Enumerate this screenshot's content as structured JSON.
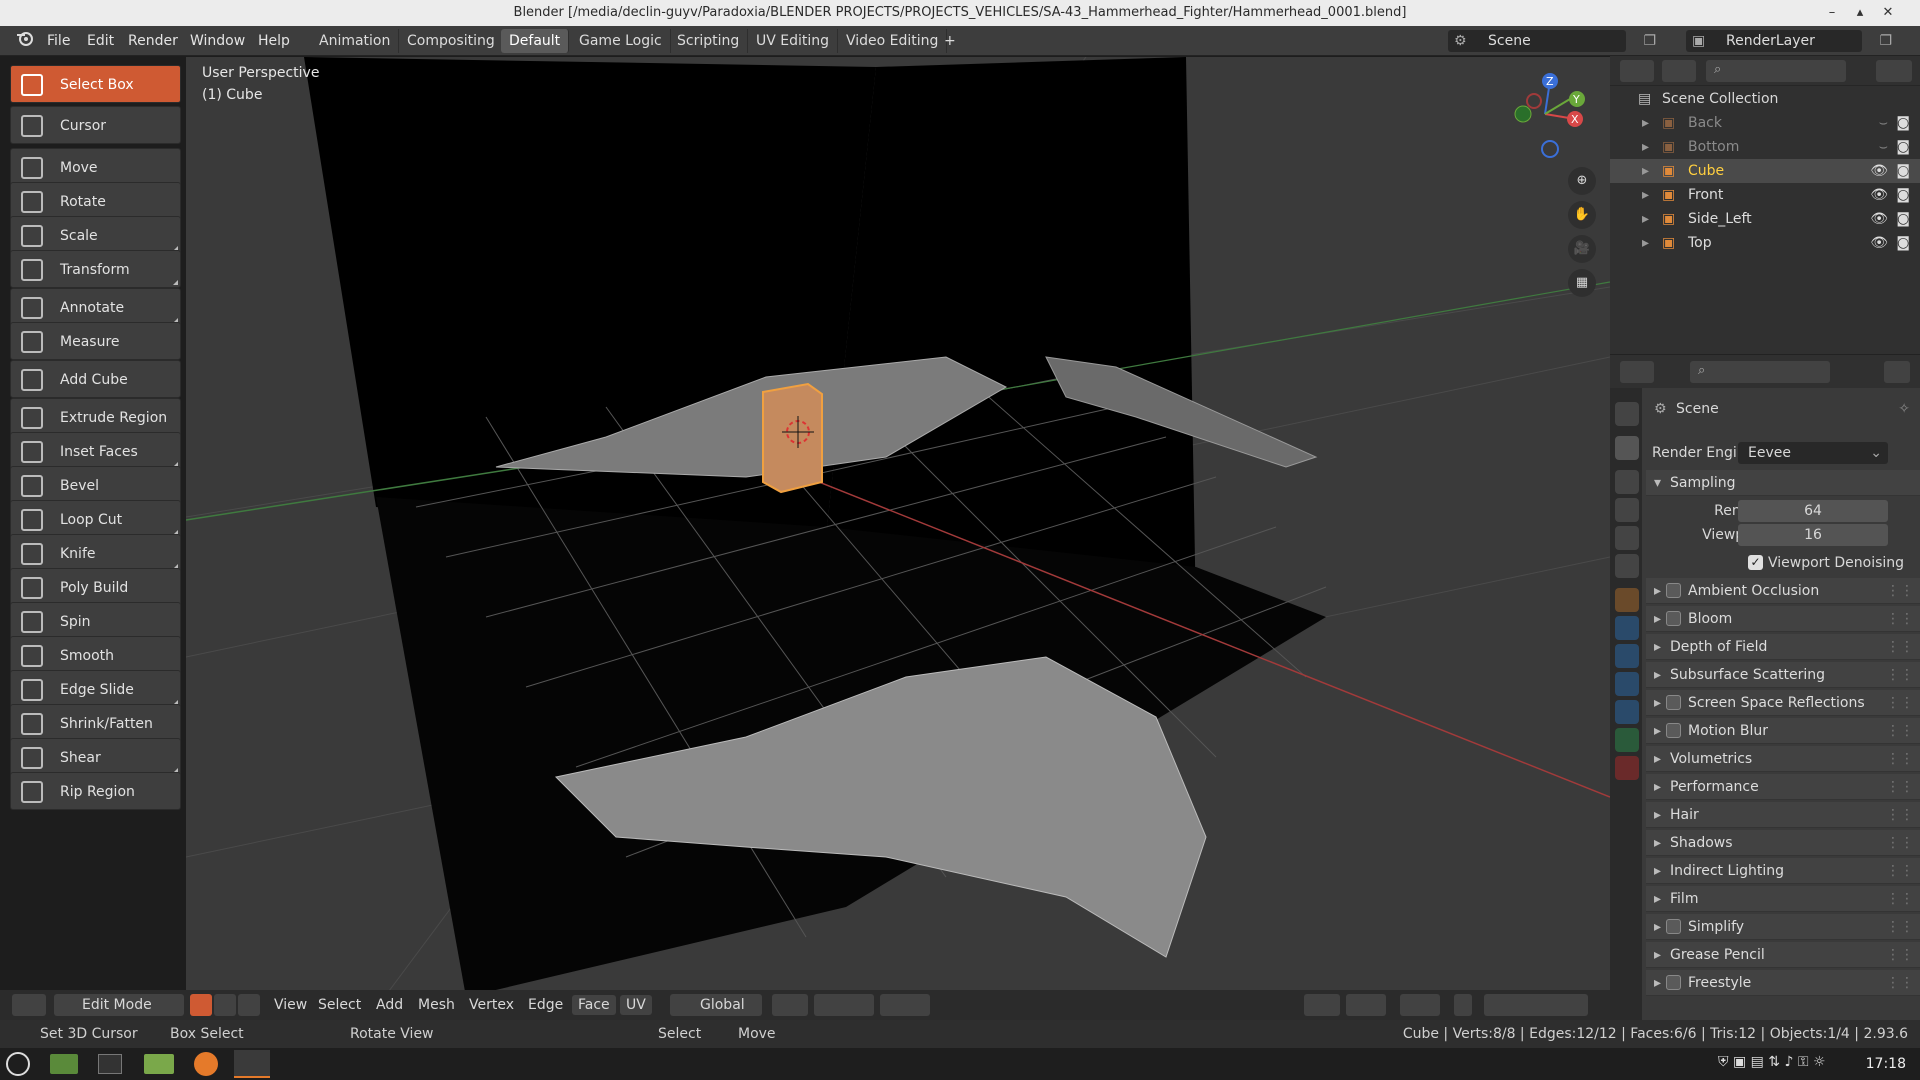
{
  "window": {
    "title": "Blender [/media/declin-guyv/Paradoxia/BLENDER PROJECTS/PROJECTS_VEHICLES/SA-43_Hammerhead_Fighter/Hammerhead_0001.blend]"
  },
  "menu": [
    "File",
    "Edit",
    "Render",
    "Window",
    "Help"
  ],
  "workspaces": [
    {
      "label": "Animation"
    },
    {
      "label": "Compositing"
    },
    {
      "label": "Default",
      "active": true
    },
    {
      "label": "Game Logic"
    },
    {
      "label": "Scripting"
    },
    {
      "label": "UV Editing"
    },
    {
      "label": "Video Editing"
    }
  ],
  "scene_field": "Scene",
  "renderlayer_field": "RenderLayer",
  "tools": [
    {
      "label": "Select Box",
      "active": true,
      "icon": "select-box-icon"
    },
    {
      "label": "Cursor",
      "icon": "cursor-icon"
    },
    {
      "label": "Move",
      "icon": "move-icon"
    },
    {
      "label": "Rotate",
      "icon": "rotate-icon"
    },
    {
      "label": "Scale",
      "icon": "scale-icon"
    },
    {
      "label": "Transform",
      "icon": "transform-icon"
    },
    {
      "label": "Annotate",
      "icon": "annotate-icon"
    },
    {
      "label": "Measure",
      "icon": "measure-icon"
    },
    {
      "label": "Add Cube",
      "icon": "add-cube-icon"
    },
    {
      "label": "Extrude Region",
      "icon": "extrude-icon"
    },
    {
      "label": "Inset Faces",
      "icon": "inset-icon"
    },
    {
      "label": "Bevel",
      "icon": "bevel-icon"
    },
    {
      "label": "Loop Cut",
      "icon": "loop-cut-icon"
    },
    {
      "label": "Knife",
      "icon": "knife-icon"
    },
    {
      "label": "Poly Build",
      "icon": "poly-build-icon"
    },
    {
      "label": "Spin",
      "icon": "spin-icon"
    },
    {
      "label": "Smooth",
      "icon": "smooth-icon"
    },
    {
      "label": "Edge Slide",
      "icon": "edge-slide-icon"
    },
    {
      "label": "Shrink/Fatten",
      "icon": "shrink-icon"
    },
    {
      "label": "Shear",
      "icon": "shear-icon"
    },
    {
      "label": "Rip Region",
      "icon": "rip-icon"
    }
  ],
  "viewport": {
    "perspective": "User Perspective",
    "object": "(1) Cube"
  },
  "vp_header": {
    "mode": "Edit Mode",
    "menus": [
      "View",
      "Select",
      "Add",
      "Mesh",
      "Vertex",
      "Edge",
      "Face",
      "UV"
    ],
    "orientation": "Global"
  },
  "statusbar": {
    "items": [
      "Set 3D Cursor",
      "Box Select",
      "Rotate View",
      "Select",
      "Move"
    ],
    "stats": "Cube | Verts:8/8 | Edges:12/12 | Faces:6/6 | Tris:12 | Objects:1/4 | 2.93.6"
  },
  "outliner": {
    "root": "Scene Collection",
    "items": [
      {
        "name": "Back",
        "dim": true
      },
      {
        "name": "Bottom",
        "dim": true
      },
      {
        "name": "Cube",
        "active": true
      },
      {
        "name": "Front"
      },
      {
        "name": "Side_Left"
      },
      {
        "name": "Top"
      }
    ]
  },
  "properties": {
    "context": "Scene",
    "render_engine_label": "Render Engine",
    "render_engine": "Eevee",
    "sampling": "Sampling",
    "render_label": "Render",
    "render_value": "64",
    "viewport_label": "Viewport",
    "viewport_value": "16",
    "denoise_label": "Viewport Denoising",
    "panels": [
      {
        "label": "Ambient Occlusion",
        "check": true
      },
      {
        "label": "Bloom",
        "check": true
      },
      {
        "label": "Depth of Field"
      },
      {
        "label": "Subsurface Scattering"
      },
      {
        "label": "Screen Space Reflections",
        "check": true
      },
      {
        "label": "Motion Blur",
        "check": true
      },
      {
        "label": "Volumetrics"
      },
      {
        "label": "Performance"
      },
      {
        "label": "Hair"
      },
      {
        "label": "Shadows"
      },
      {
        "label": "Indirect Lighting"
      },
      {
        "label": "Film"
      },
      {
        "label": "Simplify",
        "check": true
      },
      {
        "label": "Grease Pencil"
      },
      {
        "label": "Freestyle",
        "check": true
      }
    ]
  },
  "taskbar": {
    "time": "17:18"
  },
  "colors": {
    "accent": "#cf5a33",
    "selected_text": "#ffcf3f",
    "bg": "#3a3a3a"
  }
}
